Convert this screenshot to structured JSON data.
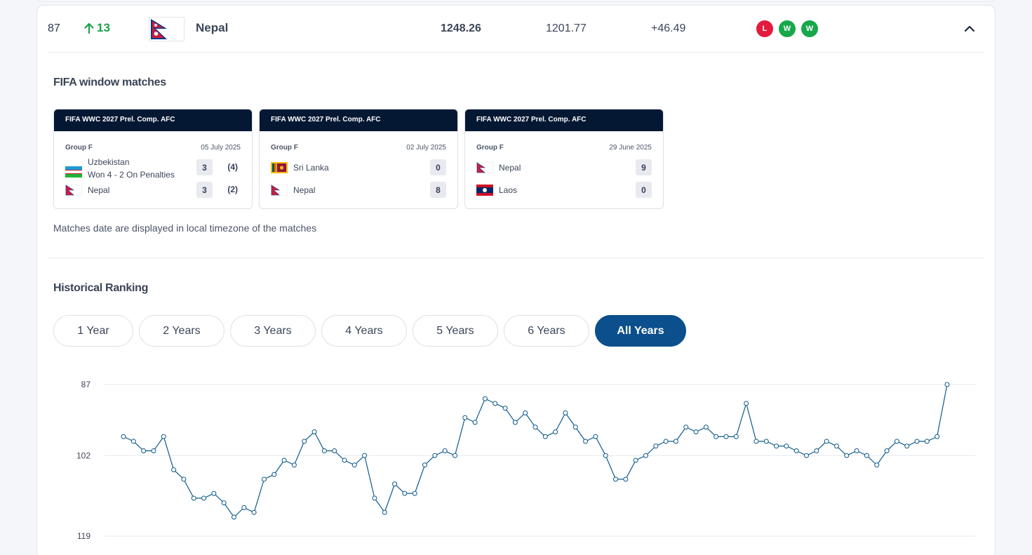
{
  "team_row": {
    "rank": "87",
    "rank_change": "13",
    "team": "Nepal",
    "total_points": "1248.26",
    "previous_points": "1201.77",
    "points_diff": "+46.49",
    "form": [
      "L",
      "W",
      "W"
    ]
  },
  "fifa_window": {
    "title": "FIFA window matches",
    "matches": [
      {
        "competition": "FIFA WWC 2027 Prel. Comp. AFC",
        "group": "Group F",
        "date": "05 July 2025",
        "home": {
          "team": "Uzbekistan",
          "note": "Won 4 - 2 On Penalties",
          "score": "3",
          "penalties": "(4)"
        },
        "away": {
          "team": "Nepal",
          "score": "3",
          "penalties": "(2)"
        }
      },
      {
        "competition": "FIFA WWC 2027 Prel. Comp. AFC",
        "group": "Group F",
        "date": "02 July 2025",
        "home": {
          "team": "Sri Lanka",
          "score": "0"
        },
        "away": {
          "team": "Nepal",
          "score": "8"
        }
      },
      {
        "competition": "FIFA WWC 2027 Prel. Comp. AFC",
        "group": "Group F",
        "date": "29 June 2025",
        "home": {
          "team": "Nepal",
          "score": "9"
        },
        "away": {
          "team": "Laos",
          "score": "0"
        }
      }
    ],
    "note": "Matches date are displayed in local timezone of the matches"
  },
  "historical": {
    "title": "Historical Ranking",
    "year_filters": [
      "1 Year",
      "2 Years",
      "3 Years",
      "4 Years",
      "5 Years",
      "6 Years",
      "All Years"
    ],
    "active_filter": "All Years"
  },
  "colors": {
    "navy": "#051833",
    "active_blue": "#0b4f8c",
    "line": "#0e5a8a",
    "loss": "#e31b3c",
    "win": "#16a84a"
  },
  "chart_data": {
    "type": "line",
    "title": "",
    "xlabel": "",
    "ylabel": "",
    "inverted_y": true,
    "ylim": [
      87,
      119
    ],
    "yticks": [
      "87",
      "102",
      "119"
    ],
    "grid": true,
    "series": [
      {
        "values": [
          98,
          99,
          101,
          101,
          98,
          105,
          107,
          111,
          111,
          110,
          112,
          115,
          113,
          114,
          107,
          106,
          103,
          104,
          99,
          97,
          101,
          101,
          103,
          104,
          102,
          111,
          114,
          108,
          110,
          110,
          104,
          102,
          101,
          102,
          94,
          95,
          90,
          91,
          92,
          95,
          93,
          96,
          98,
          97,
          93,
          96,
          99,
          98,
          102,
          107,
          107,
          103,
          102,
          100,
          99,
          99,
          96,
          97,
          96,
          98,
          98,
          98,
          91,
          99,
          99,
          100,
          100,
          101,
          102,
          101,
          99,
          100,
          102,
          101,
          102,
          104,
          101,
          99,
          100,
          99,
          99,
          98,
          87
        ]
      }
    ]
  }
}
